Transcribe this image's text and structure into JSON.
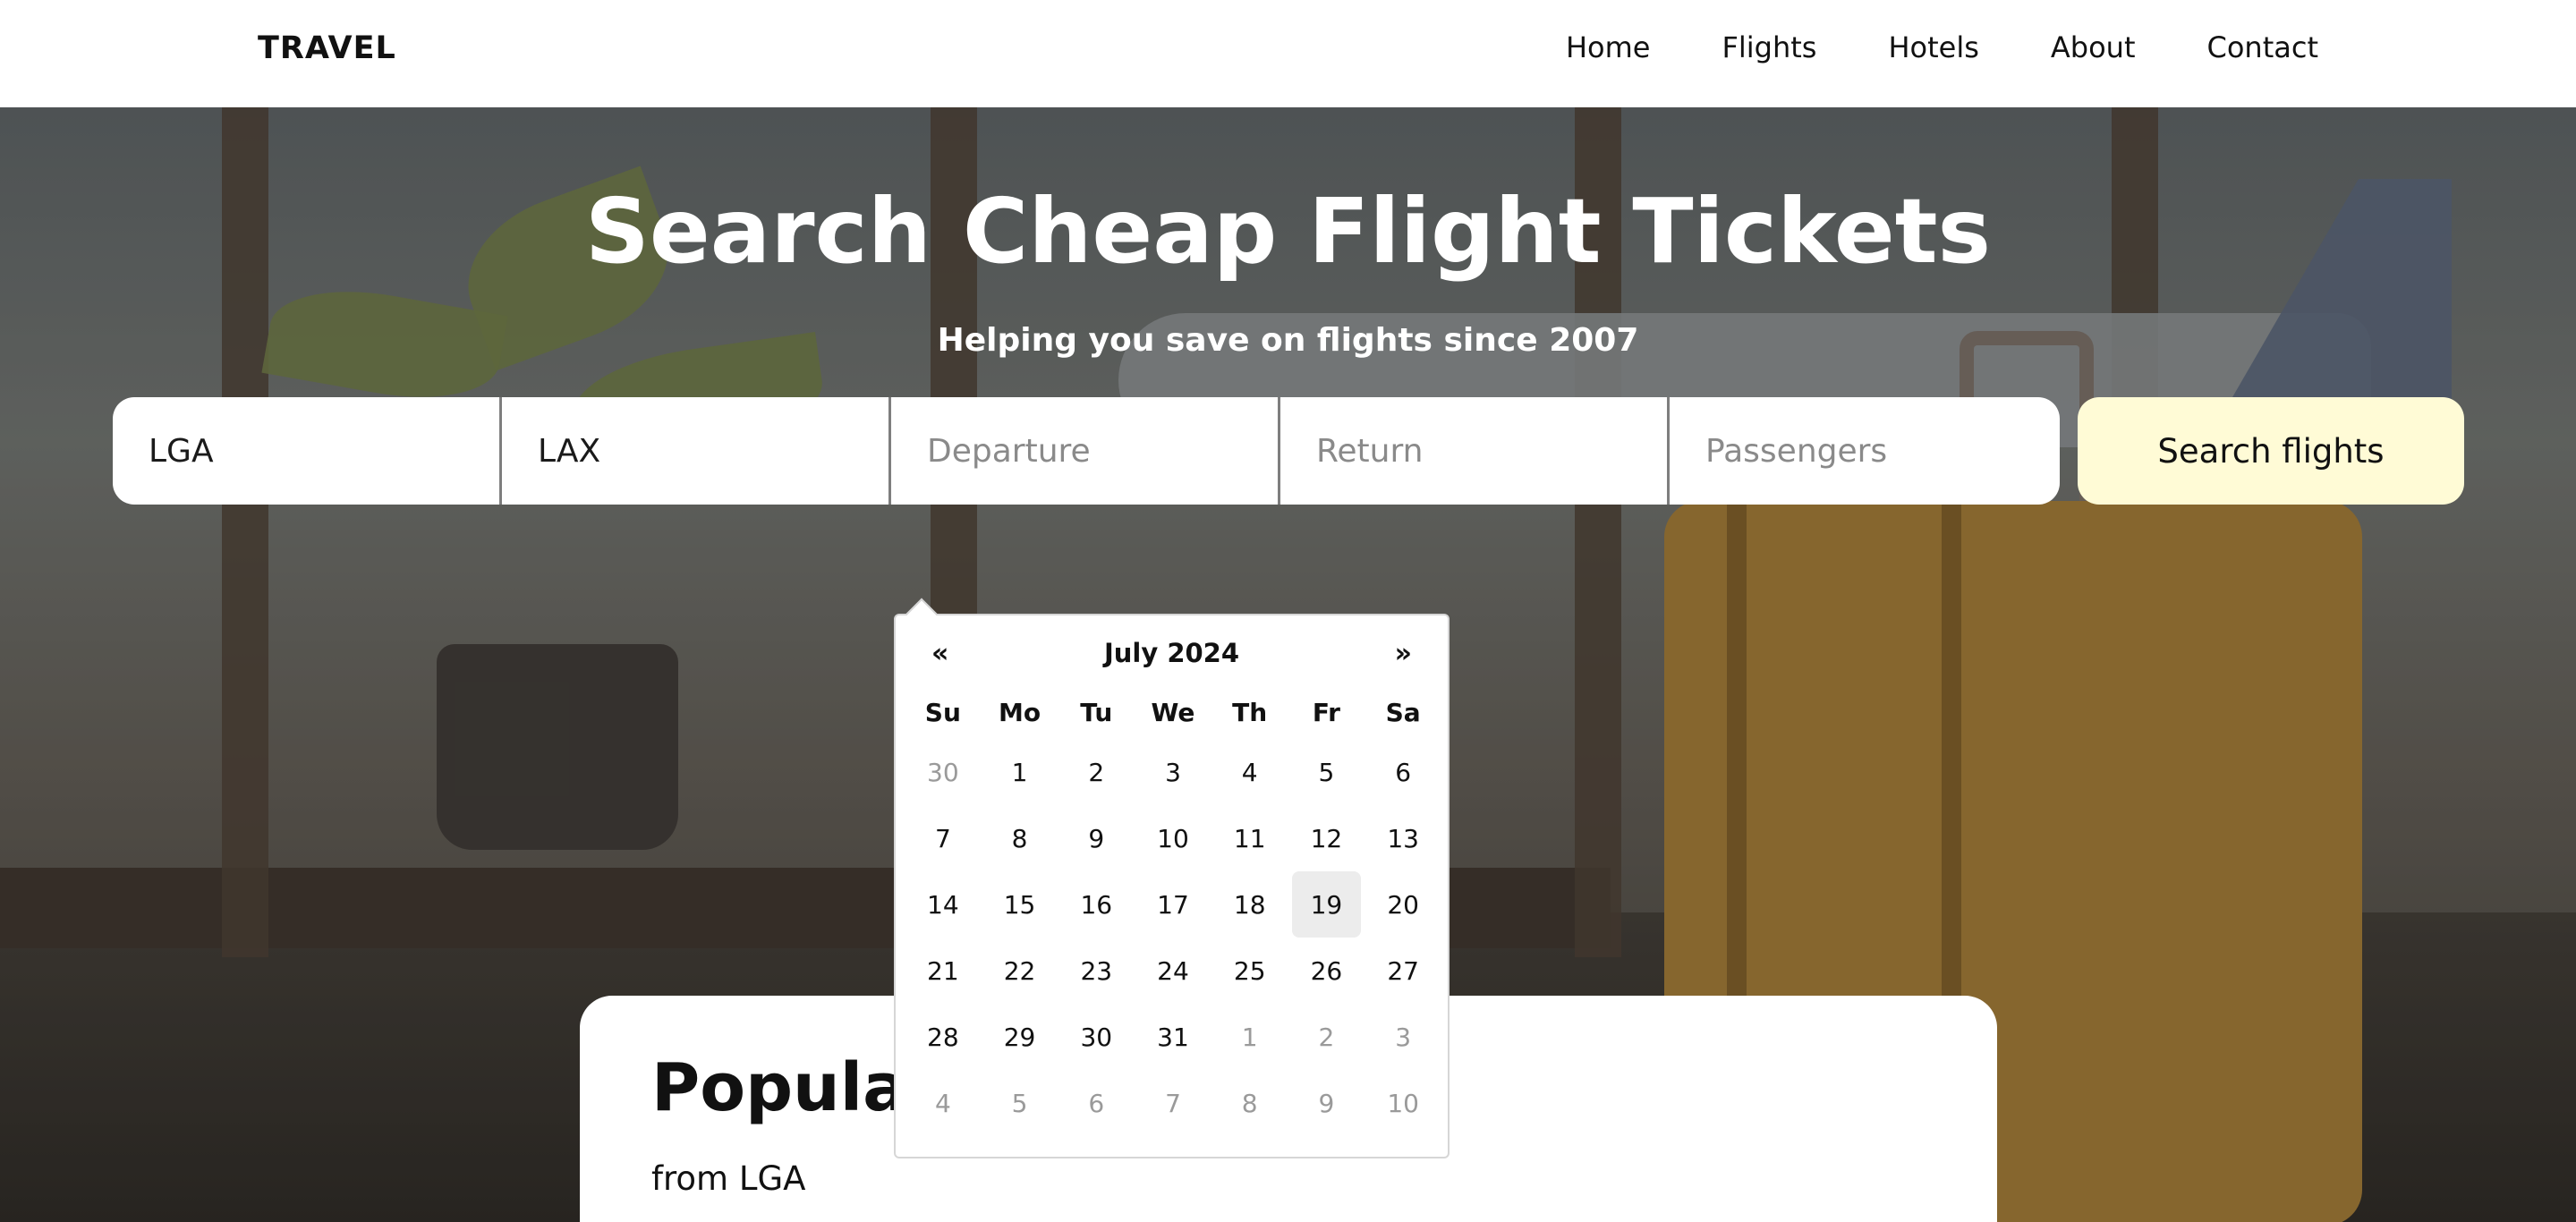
{
  "header": {
    "logo": "TRAVEL",
    "nav": [
      "Home",
      "Flights",
      "Hotels",
      "About",
      "Contact"
    ]
  },
  "hero": {
    "title": "Search Cheap Flight Tickets",
    "subtitle": "Helping you save on flights since 2007"
  },
  "search": {
    "from_value": "LGA",
    "to_value": "LAX",
    "departure_placeholder": "Departure",
    "return_placeholder": "Return",
    "passengers_placeholder": "Passengers",
    "button_label": "Search flights",
    "button_color": "#fffbd6"
  },
  "datepicker": {
    "prev": "«",
    "next": "»",
    "month_label": "July 2024",
    "weekdays": [
      "Su",
      "Mo",
      "Tu",
      "We",
      "Th",
      "Fr",
      "Sa"
    ],
    "highlighted_day": "19",
    "weeks": [
      [
        {
          "d": "30",
          "m": true
        },
        {
          "d": "1"
        },
        {
          "d": "2"
        },
        {
          "d": "3"
        },
        {
          "d": "4"
        },
        {
          "d": "5"
        },
        {
          "d": "6"
        }
      ],
      [
        {
          "d": "7"
        },
        {
          "d": "8"
        },
        {
          "d": "9"
        },
        {
          "d": "10"
        },
        {
          "d": "11"
        },
        {
          "d": "12"
        },
        {
          "d": "13"
        }
      ],
      [
        {
          "d": "14"
        },
        {
          "d": "15"
        },
        {
          "d": "16"
        },
        {
          "d": "17"
        },
        {
          "d": "18"
        },
        {
          "d": "19",
          "h": true
        },
        {
          "d": "20"
        }
      ],
      [
        {
          "d": "21"
        },
        {
          "d": "22"
        },
        {
          "d": "23"
        },
        {
          "d": "24"
        },
        {
          "d": "25"
        },
        {
          "d": "26"
        },
        {
          "d": "27"
        }
      ],
      [
        {
          "d": "28"
        },
        {
          "d": "29"
        },
        {
          "d": "30"
        },
        {
          "d": "31"
        },
        {
          "d": "1",
          "m": true
        },
        {
          "d": "2",
          "m": true
        },
        {
          "d": "3",
          "m": true
        }
      ],
      [
        {
          "d": "4",
          "m": true
        },
        {
          "d": "5",
          "m": true
        },
        {
          "d": "6",
          "m": true
        },
        {
          "d": "7",
          "m": true
        },
        {
          "d": "8",
          "m": true
        },
        {
          "d": "9",
          "m": true
        },
        {
          "d": "10",
          "m": true
        }
      ]
    ]
  },
  "popular": {
    "title": "Popular",
    "subtitle": "from LGA"
  }
}
